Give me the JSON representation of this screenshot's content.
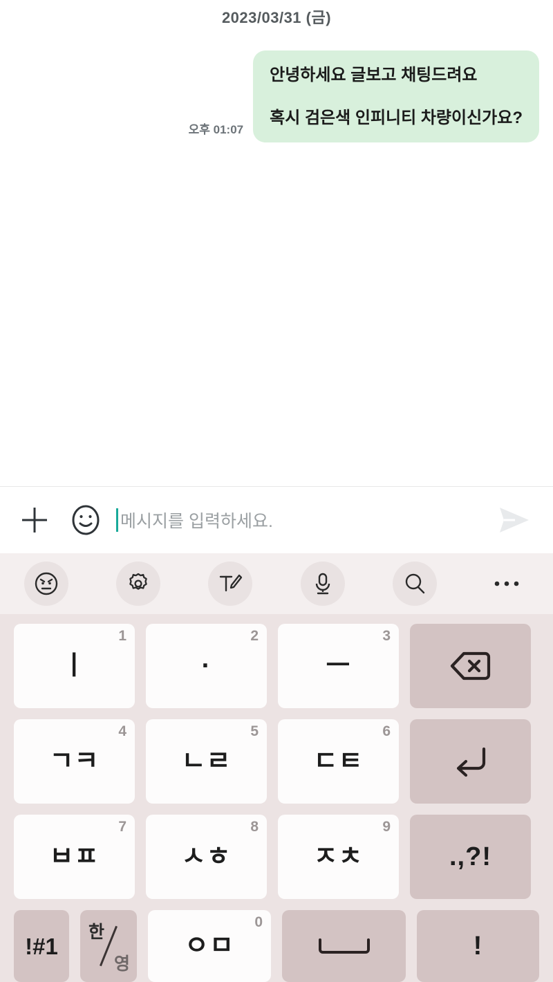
{
  "chat": {
    "date_header": "2023/03/31 (금)",
    "messages": [
      {
        "time": "오후 01:07",
        "lines": [
          "안녕하세요 글보고 채팅드려요",
          "혹시 검은색 인피니티 차량이신가요?"
        ],
        "side": "outgoing",
        "bubble_color": "#d8f0dc"
      }
    ]
  },
  "input_bar": {
    "plus_icon": "plus-icon",
    "emoji_icon": "emoji-smiley-icon",
    "placeholder": "메시지를 입력하세요.",
    "value": "",
    "send_icon": "send-arrow-icon"
  },
  "keyboard_toolbar": {
    "items": [
      {
        "icon": "emoticon-icon",
        "label": "이모티콘"
      },
      {
        "icon": "gear-icon",
        "label": "설정"
      },
      {
        "icon": "handwriting-icon",
        "label": "손글씨"
      },
      {
        "icon": "microphone-icon",
        "label": "음성 입력"
      },
      {
        "icon": "search-icon",
        "label": "검색"
      },
      {
        "icon": "more-dots-icon",
        "label": "더보기"
      }
    ]
  },
  "keyboard": {
    "type": "천지인",
    "background": "#ece3e3",
    "key_light": "#fdfcfc",
    "key_dark": "#d3c3c3",
    "rows": [
      [
        {
          "glyph": "ㅣ",
          "num": "1",
          "style": "light",
          "name": "key-i"
        },
        {
          "glyph": "·",
          "num": "2",
          "style": "light",
          "name": "key-dot"
        },
        {
          "glyph": "ㅡ",
          "num": "3",
          "style": "light",
          "name": "key-eu"
        },
        {
          "glyph": "",
          "num": "",
          "style": "dark",
          "name": "key-backspace",
          "icon": "backspace-icon"
        }
      ],
      [
        {
          "glyph": "ㄱㅋ",
          "num": "4",
          "style": "light",
          "name": "key-giyeok-kieuk"
        },
        {
          "glyph": "ㄴㄹ",
          "num": "5",
          "style": "light",
          "name": "key-nieun-rieul"
        },
        {
          "glyph": "ㄷㅌ",
          "num": "6",
          "style": "light",
          "name": "key-digeut-tieut"
        },
        {
          "glyph": "",
          "num": "",
          "style": "dark",
          "name": "key-enter",
          "icon": "enter-icon"
        }
      ],
      [
        {
          "glyph": "ㅂㅍ",
          "num": "7",
          "style": "light",
          "name": "key-bieup-pieup"
        },
        {
          "glyph": "ㅅㅎ",
          "num": "8",
          "style": "light",
          "name": "key-siot-hieut"
        },
        {
          "glyph": "ㅈㅊ",
          "num": "9",
          "style": "light",
          "name": "key-jieut-chieut"
        },
        {
          "glyph": ".,?!",
          "num": "",
          "style": "dark",
          "name": "key-punctuation"
        }
      ],
      [
        {
          "glyph": "!#1",
          "num": "",
          "style": "dark",
          "name": "key-symbols"
        },
        {
          "glyph": "한/영",
          "num": "",
          "style": "dark",
          "name": "key-language-toggle",
          "han": "한",
          "yeong": "영"
        },
        {
          "glyph": "ㅇㅁ",
          "num": "0",
          "style": "light",
          "name": "key-ieung-mieum"
        },
        {
          "glyph": "",
          "num": "",
          "style": "dark",
          "name": "key-space",
          "icon": "space-icon"
        },
        {
          "glyph": "!",
          "num": "",
          "style": "dark",
          "name": "key-exclamation"
        }
      ]
    ]
  }
}
